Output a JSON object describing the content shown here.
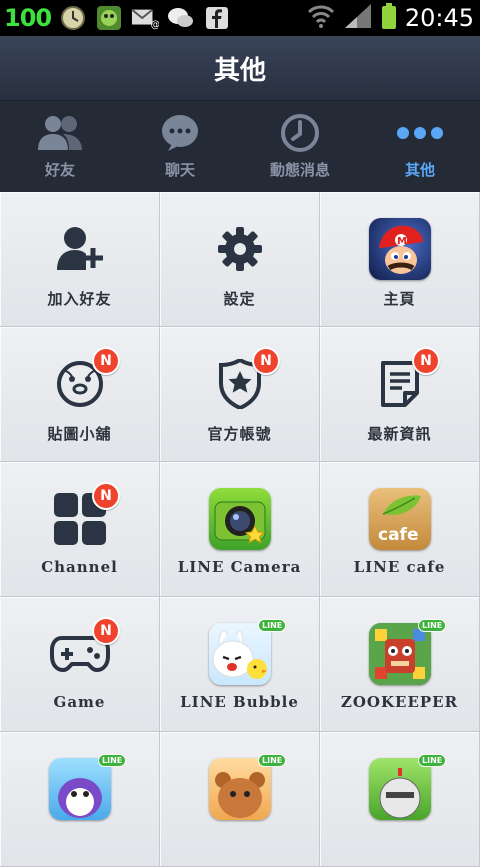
{
  "status_bar": {
    "battery_number": "100",
    "time": "20:45"
  },
  "header": {
    "title": "其他"
  },
  "tabs": [
    {
      "label": "好友",
      "icon": "friends-icon",
      "active": false
    },
    {
      "label": "聊天",
      "icon": "chat-icon",
      "active": false
    },
    {
      "label": "動態消息",
      "icon": "clock-icon",
      "active": false
    },
    {
      "label": "其他",
      "icon": "more-icon",
      "active": true
    }
  ],
  "grid": [
    {
      "label": "加入好友",
      "icon": "add-friend-icon",
      "badge": ""
    },
    {
      "label": "設定",
      "icon": "gear-icon",
      "badge": ""
    },
    {
      "label": "主頁",
      "icon": "mario-app-icon",
      "badge": ""
    },
    {
      "label": "貼圖小舖",
      "icon": "sticker-icon",
      "badge": "N"
    },
    {
      "label": "官方帳號",
      "icon": "official-account-icon",
      "badge": "N"
    },
    {
      "label": "最新資訊",
      "icon": "notice-icon",
      "badge": "N"
    },
    {
      "label": "Channel",
      "icon": "channel-icon",
      "badge": "N"
    },
    {
      "label": "LINE  Camera",
      "icon": "line-camera-icon",
      "badge": ""
    },
    {
      "label": "LINE  cafe",
      "icon": "line-cafe-icon",
      "badge": ""
    },
    {
      "label": "Game",
      "icon": "game-controller-icon",
      "badge": "N"
    },
    {
      "label": "LINE  Bubble",
      "icon": "line-bubble-icon",
      "badge": "",
      "tag": "LINE"
    },
    {
      "label": "ZOOKEEPER",
      "icon": "zookeeper-icon",
      "badge": "",
      "tag": "LINE"
    },
    {
      "label": "",
      "icon": "penguin-game-icon",
      "badge": "",
      "tag": "LINE"
    },
    {
      "label": "",
      "icon": "bear-game-icon",
      "badge": "",
      "tag": "LINE"
    },
    {
      "label": "",
      "icon": "knight-game-icon",
      "badge": "",
      "tag": "LINE"
    }
  ],
  "app_texts": {
    "cafe": "cafe"
  },
  "colors": {
    "accent": "#5aa7f5",
    "badge": "#f0432e",
    "dark_icon": "#2b3442"
  }
}
